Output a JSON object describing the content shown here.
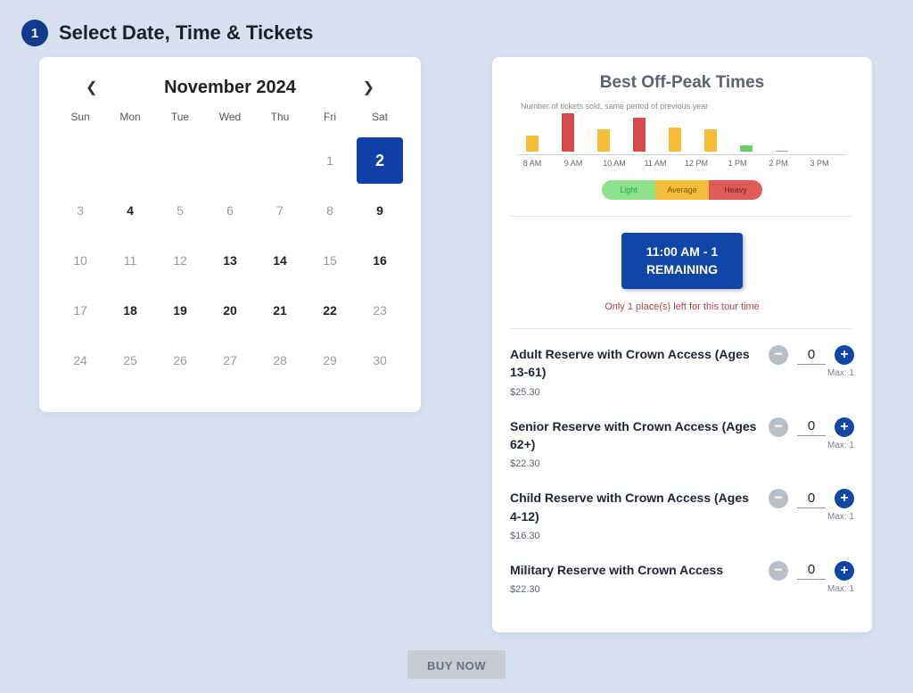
{
  "step": {
    "number": "1",
    "title": "Select Date, Time & Tickets"
  },
  "calendar": {
    "month_label": "November 2024",
    "day_headers": [
      "Sun",
      "Mon",
      "Tue",
      "Wed",
      "Thu",
      "Fri",
      "Sat"
    ],
    "weeks": [
      [
        {
          "n": "",
          "b": false
        },
        {
          "n": "",
          "b": false
        },
        {
          "n": "",
          "b": false
        },
        {
          "n": "",
          "b": false
        },
        {
          "n": "",
          "b": false
        },
        {
          "n": "1",
          "b": false
        },
        {
          "n": "2",
          "b": true,
          "sel": true
        }
      ],
      [
        {
          "n": "3",
          "b": false
        },
        {
          "n": "4",
          "b": true
        },
        {
          "n": "5",
          "b": false
        },
        {
          "n": "6",
          "b": false
        },
        {
          "n": "7",
          "b": false
        },
        {
          "n": "8",
          "b": false
        },
        {
          "n": "9",
          "b": true
        }
      ],
      [
        {
          "n": "10",
          "b": false
        },
        {
          "n": "11",
          "b": false
        },
        {
          "n": "12",
          "b": false
        },
        {
          "n": "13",
          "b": true
        },
        {
          "n": "14",
          "b": true
        },
        {
          "n": "15",
          "b": false
        },
        {
          "n": "16",
          "b": true
        }
      ],
      [
        {
          "n": "17",
          "b": false
        },
        {
          "n": "18",
          "b": true
        },
        {
          "n": "19",
          "b": true
        },
        {
          "n": "20",
          "b": true
        },
        {
          "n": "21",
          "b": true
        },
        {
          "n": "22",
          "b": true
        },
        {
          "n": "23",
          "b": false
        }
      ],
      [
        {
          "n": "24",
          "b": false
        },
        {
          "n": "25",
          "b": false
        },
        {
          "n": "26",
          "b": false
        },
        {
          "n": "27",
          "b": false
        },
        {
          "n": "28",
          "b": false
        },
        {
          "n": "29",
          "b": false
        },
        {
          "n": "30",
          "b": false
        }
      ]
    ]
  },
  "chart": {
    "title": "Best Off-Peak Times",
    "subtitle": "Number of tickets sold, same period of previous year",
    "legend": {
      "light": "Light",
      "average": "Average",
      "heavy": "Heavy"
    }
  },
  "chart_data": {
    "type": "bar",
    "title": "Best Off-Peak Times",
    "subtitle": "Number of tickets sold, same period of previous year",
    "xlabel": "",
    "ylabel": "",
    "categories": [
      "8 AM",
      "9 AM",
      "10 AM",
      "11 AM",
      "12 PM",
      "1 PM",
      "2 PM",
      "3 PM"
    ],
    "values": [
      40,
      95,
      55,
      85,
      60,
      55,
      15,
      0
    ],
    "colors": [
      "#f5bd3a",
      "#d44a4a",
      "#f5bd3a",
      "#d44a4a",
      "#f5bd3a",
      "#f5bd3a",
      "#6cc96c",
      "#6cc96c"
    ],
    "load_class": [
      "average",
      "heavy",
      "average",
      "heavy",
      "average",
      "average",
      "light",
      "light"
    ],
    "legend_levels": [
      "Light",
      "Average",
      "Heavy"
    ],
    "ylim": [
      0,
      100
    ]
  },
  "timeslot": {
    "line1": "11:00 AM - 1",
    "line2": "REMAINING",
    "note": "Only 1 place(s) left for this tour time"
  },
  "tickets": [
    {
      "name": "Adult Reserve with Crown Access (Ages 13-61)",
      "price": "$25.30",
      "qty": "0",
      "max": "Max: 1"
    },
    {
      "name": "Senior Reserve with Crown Access (Ages 62+)",
      "price": "$22.30",
      "qty": "0",
      "max": "Max: 1"
    },
    {
      "name": "Child Reserve with Crown Access (Ages 4-12)",
      "price": "$16.30",
      "qty": "0",
      "max": "Max: 1"
    },
    {
      "name": "Military Reserve with Crown Access",
      "price": "$22.30",
      "qty": "0",
      "max": "Max: 1"
    }
  ],
  "buy_now": "BUY NOW"
}
